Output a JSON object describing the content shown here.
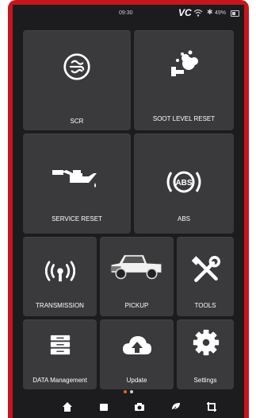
{
  "status": {
    "time": "09:30",
    "vci": "VC",
    "battery": "49%"
  },
  "tiles": [
    {
      "label": "SCR",
      "icon": "scr-emission-icon"
    },
    {
      "label": "SOOT LEVEL RESET",
      "icon": "soot-level-icon"
    },
    {
      "label": "SERVICE RESET",
      "icon": "oil-can-icon"
    },
    {
      "label": "ABS",
      "icon": "abs-icon"
    },
    {
      "label": "TRANSMISSION",
      "icon": "transmission-signal-icon"
    },
    {
      "label": "PICKUP",
      "icon": "pickup-truck-icon"
    },
    {
      "label": "TOOLS",
      "icon": "tools-icon"
    },
    {
      "label": "DATA Management",
      "icon": "data-storage-icon"
    },
    {
      "label": "Update",
      "icon": "cloud-upload-icon"
    },
    {
      "label": "Settings",
      "icon": "gear-icon"
    }
  ],
  "pagination": {
    "current": 1,
    "total": 2
  },
  "navbar": [
    "home-icon",
    "folder-icon",
    "camera-icon",
    "feedback-icon",
    "screenshot-icon"
  ],
  "colors": {
    "frame": "#c8141c",
    "tile": "#3a3a3d",
    "dot_active": "#e8661e",
    "dot_inactive": "#cfcfcf"
  }
}
